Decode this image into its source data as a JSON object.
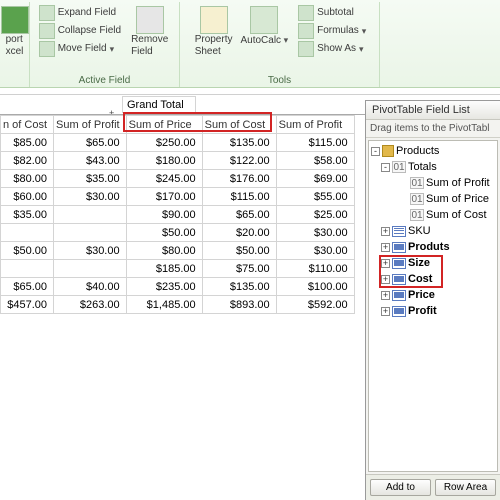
{
  "ribbon": {
    "export_excel": "port\nxcel",
    "expand_field": "Expand Field",
    "collapse_field": "Collapse Field",
    "move_field": "Move Field",
    "remove_field": "Remove\nField",
    "group_active": "Active Field",
    "property_sheet": "Property\nSheet",
    "autocalc": "AutoCalc",
    "subtotal": "Subtotal",
    "formulas": "Formulas",
    "show_as": "Show As",
    "group_tools": "Tools"
  },
  "pivot": {
    "grand_total": "Grand Total",
    "headers": [
      "n of Cost",
      "Sum of Profit",
      "Sum of Price",
      "Sum of Cost",
      "Sum of Profit"
    ],
    "rows": [
      [
        "$85.00",
        "$65.00",
        "$250.00",
        "$135.00",
        "$115.00"
      ],
      [
        "$82.00",
        "$43.00",
        "$180.00",
        "$122.00",
        "$58.00"
      ],
      [
        "$80.00",
        "$35.00",
        "$245.00",
        "$176.00",
        "$69.00"
      ],
      [
        "$60.00",
        "$30.00",
        "$170.00",
        "$115.00",
        "$55.00"
      ],
      [
        "$35.00",
        "",
        "$90.00",
        "$65.00",
        "$25.00"
      ],
      [
        "",
        "",
        "$50.00",
        "$20.00",
        "$30.00"
      ],
      [
        "$50.00",
        "$30.00",
        "$80.00",
        "$50.00",
        "$30.00"
      ],
      [
        "",
        "",
        "$185.00",
        "$75.00",
        "$110.00"
      ],
      [
        "$65.00",
        "$40.00",
        "$235.00",
        "$135.00",
        "$100.00"
      ],
      [
        "$457.00",
        "$263.00",
        "$1,485.00",
        "$893.00",
        "$592.00"
      ]
    ]
  },
  "fieldlist": {
    "title": "PivotTable Field List",
    "hint": "Drag items to the PivotTabl",
    "root": "Products",
    "totals": "Totals",
    "totals_children": [
      "Sum of Profit",
      "Sum of Price",
      "Sum of Cost"
    ],
    "fields": [
      "SKU",
      "Produts",
      "Size",
      "Cost",
      "Price",
      "Profit"
    ],
    "add_to": "Add to",
    "row_area": "Row Area"
  }
}
